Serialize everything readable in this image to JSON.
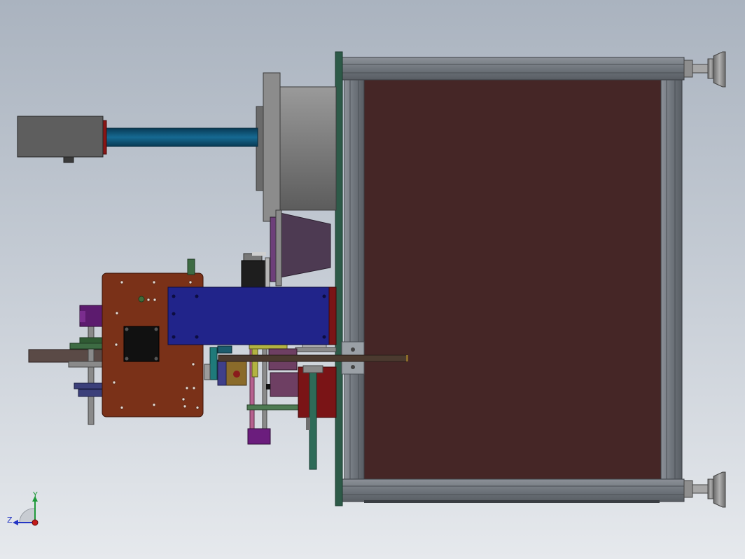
{
  "viewport": {
    "background_top": "#aab3bf",
    "background_bottom": "#e6e9ed"
  },
  "colors": {
    "frame_profile": "#6f757c",
    "frame_panel": "#452626",
    "front_plate": "#2d5a48",
    "drum": "#7b7b7b",
    "shaft": "#0f4d6e",
    "motor_box": "#5e5e5e",
    "copper_plate": "#7a3118",
    "blue_housing": "#21248a",
    "purple_block": "#5c1b6e",
    "dark_red_block": "#7a1416",
    "rail": "#4b3a2f",
    "leveling_foot": "#8b8b8b"
  },
  "triad": {
    "y_label": "Y",
    "z_label": "Z",
    "y_color": "#1f9a3a",
    "z_color": "#2436c4",
    "x_color": "#c41a1a"
  }
}
